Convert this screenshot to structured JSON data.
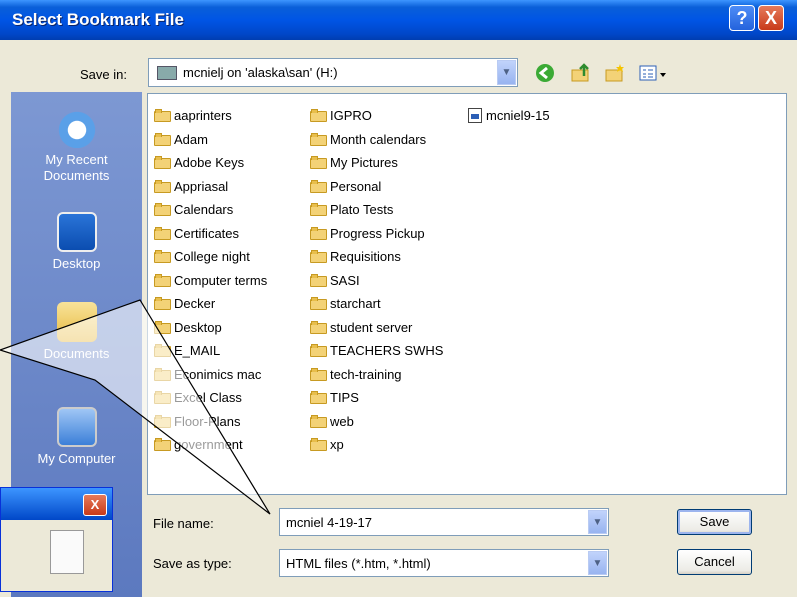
{
  "window": {
    "title": "Select Bookmark File",
    "help_label": "?",
    "close_label": "X"
  },
  "save_in": {
    "label": "Save in:",
    "value": "mcnielj on 'alaska\\san' (H:)"
  },
  "toolbar": {
    "icons": [
      "back-icon",
      "up-folder-icon",
      "new-folder-icon",
      "view-menu-icon"
    ]
  },
  "places": [
    {
      "label": "My Recent Documents",
      "icon": "recent-documents-icon"
    },
    {
      "label": "Desktop",
      "icon": "desktop-icon"
    },
    {
      "label": "Documents",
      "icon": "my-documents-icon"
    },
    {
      "label": "My Computer",
      "icon": "my-computer-icon"
    }
  ],
  "files": {
    "col1": [
      "aaprinters",
      "Adam",
      "Adobe Keys",
      "Appriasal",
      "Calendars",
      "Certificates",
      "College night",
      "Computer terms",
      "Decker",
      "Desktop",
      "E_MAIL",
      "Econimics mac",
      "Excel Class",
      "Floor-Plans",
      "government"
    ],
    "col2": [
      "IGPRO",
      "Month calendars",
      "My Pictures",
      "Personal",
      "Plato Tests",
      "Progress Pickup",
      "Requisitions",
      "SASI",
      "starchart",
      "student server",
      "TEACHERS SWHS",
      "tech-training",
      "TIPS",
      "web",
      "xp"
    ],
    "col3": [
      "mcniel9-15"
    ]
  },
  "file_name": {
    "label": "File name:",
    "value": "mcniel 4-19-17"
  },
  "save_as_type": {
    "label": "Save as type:",
    "value": "HTML files (*.htm, *.html)"
  },
  "buttons": {
    "save": "Save",
    "cancel": "Cancel"
  }
}
